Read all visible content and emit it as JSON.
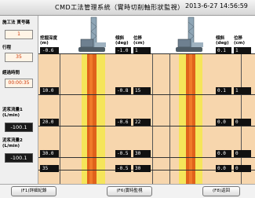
{
  "window": {
    "title": "CMD工法管理系統（實時切削軸形狀監視）",
    "datetime": "2013-6-27  14:56:59"
  },
  "sidebar": {
    "method_label": "施工法 貫号碼",
    "method_value": "1",
    "row_label": "行程",
    "row_value": "35",
    "elapsed_label": "經過時間",
    "elapsed_value": "00:00:35",
    "flow1_label_line1": "泥浆流量1",
    "flow1_label_line2": "(L/min)",
    "flow1_value": "-100.1",
    "flow2_label_line1": "泥浆流量2",
    "flow2_label_line2": "(L/min)",
    "flow2_value": "-100.1"
  },
  "headers": {
    "depth_line1": "挖掘深度",
    "depth_line2": "(m)",
    "left_angle_line1": "傾斜",
    "left_angle_line2": "(deg)",
    "left_pos_line1": "位移",
    "left_pos_line2": "(cm)",
    "right_angle_line1": "傾斜",
    "right_angle_line2": "(deg)",
    "right_pos_line1": "位移",
    "right_pos_line2": "(cm)"
  },
  "rows": [
    {
      "depth": "-0.6",
      "l_angle": "-1.0",
      "l_pos": "1",
      "r_angle": "0.1",
      "r_pos": "1"
    },
    {
      "depth": "10.0",
      "l_angle": "-0.8",
      "l_pos": "15",
      "r_angle": "0.1",
      "r_pos": "1"
    },
    {
      "depth": "20.0",
      "l_angle": "-0.6",
      "l_pos": "22",
      "r_angle": "0.0",
      "r_pos": "0"
    },
    {
      "depth": "30.0",
      "l_angle": "-0.5",
      "l_pos": "30",
      "r_angle": "0.0",
      "r_pos": "0"
    },
    {
      "depth": "35",
      "l_angle": "-0.5",
      "l_pos": "30",
      "r_angle": "0.0",
      "r_pos": "0"
    }
  ],
  "buttons": {
    "left": "(F1)詳細紀錄",
    "center": "(F6)實時監視",
    "right": "(F8)返回"
  },
  "colors": {
    "ground": "#f7d6ad",
    "pile_outer": "#f5e55a",
    "pile_inner": "#e0621b"
  }
}
